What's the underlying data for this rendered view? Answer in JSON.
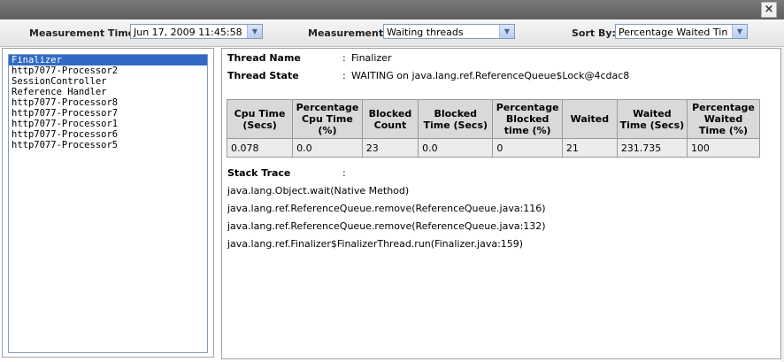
{
  "window": {
    "close_label": "×"
  },
  "toolbar": {
    "measurement_time_label": "Measurement Time:",
    "measurement_time_value": "Jun 17, 2009 11:45:58",
    "measurement_label": "Measurement:",
    "measurement_value": "Waiting threads",
    "sort_by_label": "Sort By:",
    "sort_by_value": "Percentage Waited Tin"
  },
  "threads": [
    "Finalizer",
    "http7077-Processor2",
    "SessionController",
    "Reference Handler",
    "http7077-Processor8",
    "http7077-Processor7",
    "http7077-Processor1",
    "http7077-Processor6",
    "http7077-Processor5"
  ],
  "details": {
    "thread_name_label": "Thread Name",
    "thread_name_value": "Finalizer",
    "thread_state_label": "Thread State",
    "thread_state_value": "WAITING on java.lang.ref.ReferenceQueue$Lock@4cdac8",
    "colon": ":"
  },
  "stats": {
    "headers": [
      "Cpu Time (Secs)",
      "Percentage Cpu Time (%)",
      "Blocked Count",
      "Blocked Time (Secs)",
      "Percentage Blocked time (%)",
      "Waited",
      "Waited Time (Secs)",
      "Percentage Waited Time (%)"
    ],
    "values": [
      "0.078",
      "0.0",
      "23",
      "0.0",
      "0",
      "21",
      "231.735",
      "100"
    ]
  },
  "stack_trace": {
    "label": "Stack Trace",
    "lines": [
      "java.lang.Object.wait(Native Method)",
      "java.lang.ref.ReferenceQueue.remove(ReferenceQueue.java:116)",
      "java.lang.ref.ReferenceQueue.remove(ReferenceQueue.java:132)",
      "java.lang.ref.Finalizer$FinalizerThread.run(Finalizer.java:159)"
    ]
  }
}
